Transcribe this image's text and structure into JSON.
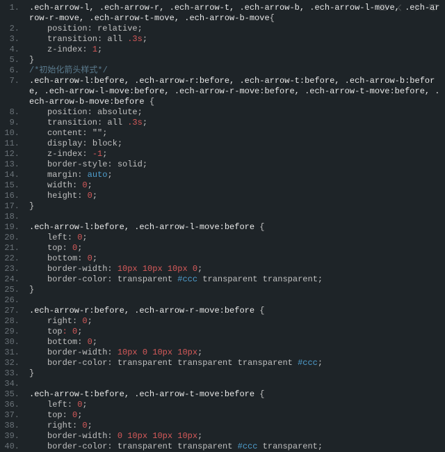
{
  "toolbar": {
    "icons": [
      "list-icon",
      "back-icon",
      "forward-icon",
      "screen-icon"
    ]
  },
  "code": {
    "lines": [
      {
        "n": 1,
        "seg": [
          {
            "c": "tok-sel",
            "t": ".ech-arrow-l, .ech-arrow-r, .ech-arrow-t, .ech-arrow-b, .ech-arrow-l-move, .ech-arrow-r-move, .ech-arrow-t-move, .ech-arrow-b-move"
          },
          {
            "c": "tok-punc",
            "t": "{"
          }
        ]
      },
      {
        "n": 2,
        "i": 1,
        "seg": [
          {
            "c": "tok-prop",
            "t": "position"
          },
          {
            "c": "tok-punc",
            "t": ": "
          },
          {
            "c": "tok-val",
            "t": "relative"
          },
          {
            "c": "tok-punc",
            "t": ";"
          }
        ]
      },
      {
        "n": 3,
        "i": 1,
        "seg": [
          {
            "c": "tok-prop",
            "t": "transition"
          },
          {
            "c": "tok-punc",
            "t": ": "
          },
          {
            "c": "tok-val",
            "t": "all "
          },
          {
            "c": "tok-time",
            "t": ".3s"
          },
          {
            "c": "tok-punc",
            "t": ";"
          }
        ]
      },
      {
        "n": 4,
        "i": 1,
        "seg": [
          {
            "c": "tok-prop",
            "t": "z-index"
          },
          {
            "c": "tok-punc",
            "t": ": "
          },
          {
            "c": "tok-num",
            "t": "1"
          },
          {
            "c": "tok-punc",
            "t": ";"
          }
        ]
      },
      {
        "n": 5,
        "seg": [
          {
            "c": "tok-punc",
            "t": "}"
          }
        ]
      },
      {
        "n": 6,
        "seg": [
          {
            "c": "tok-cmt",
            "t": "/*初始化箭头样式*/"
          }
        ]
      },
      {
        "n": 7,
        "seg": [
          {
            "c": "tok-sel",
            "t": ".ech-arrow-l:before, .ech-arrow-r:before, .ech-arrow-t:before, .ech-arrow-b:before, .ech-arrow-l-move:before, .ech-arrow-r-move:before, .ech-arrow-t-move:before, .ech-arrow-b-move:before "
          },
          {
            "c": "tok-punc",
            "t": "{"
          }
        ]
      },
      {
        "n": 8,
        "i": 1,
        "seg": [
          {
            "c": "tok-prop",
            "t": "position"
          },
          {
            "c": "tok-punc",
            "t": ": "
          },
          {
            "c": "tok-val",
            "t": "absolute"
          },
          {
            "c": "tok-punc",
            "t": ";"
          }
        ]
      },
      {
        "n": 9,
        "i": 1,
        "seg": [
          {
            "c": "tok-prop",
            "t": "transition"
          },
          {
            "c": "tok-punc",
            "t": ": "
          },
          {
            "c": "tok-val",
            "t": "all "
          },
          {
            "c": "tok-time",
            "t": ".3s"
          },
          {
            "c": "tok-punc",
            "t": ";"
          }
        ]
      },
      {
        "n": 10,
        "i": 1,
        "seg": [
          {
            "c": "tok-prop",
            "t": "content"
          },
          {
            "c": "tok-punc",
            "t": ": "
          },
          {
            "c": "tok-val",
            "t": "\"\""
          },
          {
            "c": "tok-punc",
            "t": ";"
          }
        ]
      },
      {
        "n": 11,
        "i": 1,
        "seg": [
          {
            "c": "tok-prop",
            "t": "display"
          },
          {
            "c": "tok-punc",
            "t": ": "
          },
          {
            "c": "tok-val",
            "t": "block"
          },
          {
            "c": "tok-punc",
            "t": ";"
          }
        ]
      },
      {
        "n": 12,
        "i": 1,
        "seg": [
          {
            "c": "tok-prop",
            "t": "z-index"
          },
          {
            "c": "tok-punc",
            "t": ": "
          },
          {
            "c": "tok-num",
            "t": "-1"
          },
          {
            "c": "tok-punc",
            "t": ";"
          }
        ]
      },
      {
        "n": 13,
        "i": 1,
        "seg": [
          {
            "c": "tok-prop",
            "t": "border-style"
          },
          {
            "c": "tok-punc",
            "t": ": "
          },
          {
            "c": "tok-val",
            "t": "solid"
          },
          {
            "c": "tok-punc",
            "t": ";"
          }
        ]
      },
      {
        "n": 14,
        "i": 1,
        "seg": [
          {
            "c": "tok-prop",
            "t": "margin"
          },
          {
            "c": "tok-punc",
            "t": ": "
          },
          {
            "c": "tok-kw",
            "t": "auto"
          },
          {
            "c": "tok-punc",
            "t": ";"
          }
        ]
      },
      {
        "n": 15,
        "i": 1,
        "seg": [
          {
            "c": "tok-prop",
            "t": "width"
          },
          {
            "c": "tok-punc",
            "t": ": "
          },
          {
            "c": "tok-num",
            "t": "0"
          },
          {
            "c": "tok-punc",
            "t": ";"
          }
        ]
      },
      {
        "n": 16,
        "i": 1,
        "seg": [
          {
            "c": "tok-prop",
            "t": "height"
          },
          {
            "c": "tok-punc",
            "t": ": "
          },
          {
            "c": "tok-num",
            "t": "0"
          },
          {
            "c": "tok-punc",
            "t": ";"
          }
        ]
      },
      {
        "n": 17,
        "seg": [
          {
            "c": "tok-punc",
            "t": "}"
          }
        ]
      },
      {
        "n": 18,
        "seg": []
      },
      {
        "n": 19,
        "seg": [
          {
            "c": "tok-sel",
            "t": ".ech-arrow-l:before, .ech-arrow-l-move:before "
          },
          {
            "c": "tok-punc",
            "t": "{"
          }
        ]
      },
      {
        "n": 20,
        "i": 1,
        "seg": [
          {
            "c": "tok-prop",
            "t": "left"
          },
          {
            "c": "tok-punc",
            "t": ": "
          },
          {
            "c": "tok-num",
            "t": "0"
          },
          {
            "c": "tok-punc",
            "t": ";"
          }
        ]
      },
      {
        "n": 21,
        "i": 1,
        "seg": [
          {
            "c": "tok-prop",
            "t": "top"
          },
          {
            "c": "tok-punc",
            "t": ": "
          },
          {
            "c": "tok-num",
            "t": "0"
          },
          {
            "c": "tok-punc",
            "t": ";"
          }
        ]
      },
      {
        "n": 22,
        "i": 1,
        "seg": [
          {
            "c": "tok-prop",
            "t": "bottom"
          },
          {
            "c": "tok-punc",
            "t": ": "
          },
          {
            "c": "tok-num",
            "t": "0"
          },
          {
            "c": "tok-punc",
            "t": ";"
          }
        ]
      },
      {
        "n": 23,
        "i": 1,
        "seg": [
          {
            "c": "tok-prop",
            "t": "border-width"
          },
          {
            "c": "tok-punc",
            "t": ": "
          },
          {
            "c": "tok-num",
            "t": "10px 10px 10px 0"
          },
          {
            "c": "tok-punc",
            "t": ";"
          }
        ]
      },
      {
        "n": 24,
        "i": 1,
        "seg": [
          {
            "c": "tok-prop",
            "t": "border-color"
          },
          {
            "c": "tok-punc",
            "t": ": "
          },
          {
            "c": "tok-val",
            "t": "transparent "
          },
          {
            "c": "tok-hex",
            "t": "#ccc"
          },
          {
            "c": "tok-val",
            "t": " transparent transparent"
          },
          {
            "c": "tok-punc",
            "t": ";"
          }
        ]
      },
      {
        "n": 25,
        "seg": [
          {
            "c": "tok-punc",
            "t": "}"
          }
        ]
      },
      {
        "n": 26,
        "seg": []
      },
      {
        "n": 27,
        "seg": [
          {
            "c": "tok-sel",
            "t": ".ech-arrow-r:before, .ech-arrow-r-move:before "
          },
          {
            "c": "tok-punc",
            "t": "{"
          }
        ]
      },
      {
        "n": 28,
        "i": 1,
        "seg": [
          {
            "c": "tok-prop",
            "t": "right"
          },
          {
            "c": "tok-punc",
            "t": ": "
          },
          {
            "c": "tok-num",
            "t": "0"
          },
          {
            "c": "tok-punc",
            "t": ";"
          }
        ]
      },
      {
        "n": 29,
        "i": 1,
        "seg": [
          {
            "c": "tok-prop",
            "t": "top"
          },
          {
            "c": "tok-num",
            "t": ": 0"
          },
          {
            "c": "tok-punc",
            "t": ";"
          }
        ]
      },
      {
        "n": 30,
        "i": 1,
        "seg": [
          {
            "c": "tok-prop",
            "t": "bottom"
          },
          {
            "c": "tok-punc",
            "t": ": "
          },
          {
            "c": "tok-num",
            "t": "0"
          },
          {
            "c": "tok-punc",
            "t": ";"
          }
        ]
      },
      {
        "n": 31,
        "i": 1,
        "seg": [
          {
            "c": "tok-prop",
            "t": "border-width"
          },
          {
            "c": "tok-punc",
            "t": ": "
          },
          {
            "c": "tok-num",
            "t": "10px 0 10px 10px"
          },
          {
            "c": "tok-punc",
            "t": ";"
          }
        ]
      },
      {
        "n": 32,
        "i": 1,
        "seg": [
          {
            "c": "tok-prop",
            "t": "border-color"
          },
          {
            "c": "tok-punc",
            "t": ": "
          },
          {
            "c": "tok-val",
            "t": "transparent transparent transparent "
          },
          {
            "c": "tok-hex",
            "t": "#ccc"
          },
          {
            "c": "tok-punc",
            "t": ";"
          }
        ]
      },
      {
        "n": 33,
        "seg": [
          {
            "c": "tok-punc",
            "t": "}"
          }
        ]
      },
      {
        "n": 34,
        "seg": []
      },
      {
        "n": 35,
        "seg": [
          {
            "c": "tok-sel",
            "t": ".ech-arrow-t:before, .ech-arrow-t-move:before "
          },
          {
            "c": "tok-punc",
            "t": "{"
          }
        ]
      },
      {
        "n": 36,
        "i": 1,
        "seg": [
          {
            "c": "tok-prop",
            "t": "left"
          },
          {
            "c": "tok-punc",
            "t": ": "
          },
          {
            "c": "tok-num",
            "t": "0"
          },
          {
            "c": "tok-punc",
            "t": ";"
          }
        ]
      },
      {
        "n": 37,
        "i": 1,
        "seg": [
          {
            "c": "tok-prop",
            "t": "top"
          },
          {
            "c": "tok-punc",
            "t": ": "
          },
          {
            "c": "tok-num",
            "t": "0"
          },
          {
            "c": "tok-punc",
            "t": ";"
          }
        ]
      },
      {
        "n": 38,
        "i": 1,
        "seg": [
          {
            "c": "tok-prop",
            "t": "right"
          },
          {
            "c": "tok-punc",
            "t": ": "
          },
          {
            "c": "tok-num",
            "t": "0"
          },
          {
            "c": "tok-punc",
            "t": ";"
          }
        ]
      },
      {
        "n": 39,
        "i": 1,
        "seg": [
          {
            "c": "tok-prop",
            "t": "border-width"
          },
          {
            "c": "tok-punc",
            "t": ": "
          },
          {
            "c": "tok-num",
            "t": "0 10px 10px 10px"
          },
          {
            "c": "tok-punc",
            "t": ";"
          }
        ]
      },
      {
        "n": 40,
        "i": 1,
        "seg": [
          {
            "c": "tok-prop",
            "t": "border-color"
          },
          {
            "c": "tok-punc",
            "t": ": "
          },
          {
            "c": "tok-val",
            "t": "transparent transparent "
          },
          {
            "c": "tok-hex",
            "t": "#ccc"
          },
          {
            "c": "tok-val",
            "t": " transparent"
          },
          {
            "c": "tok-punc",
            "t": ";"
          }
        ]
      }
    ]
  }
}
